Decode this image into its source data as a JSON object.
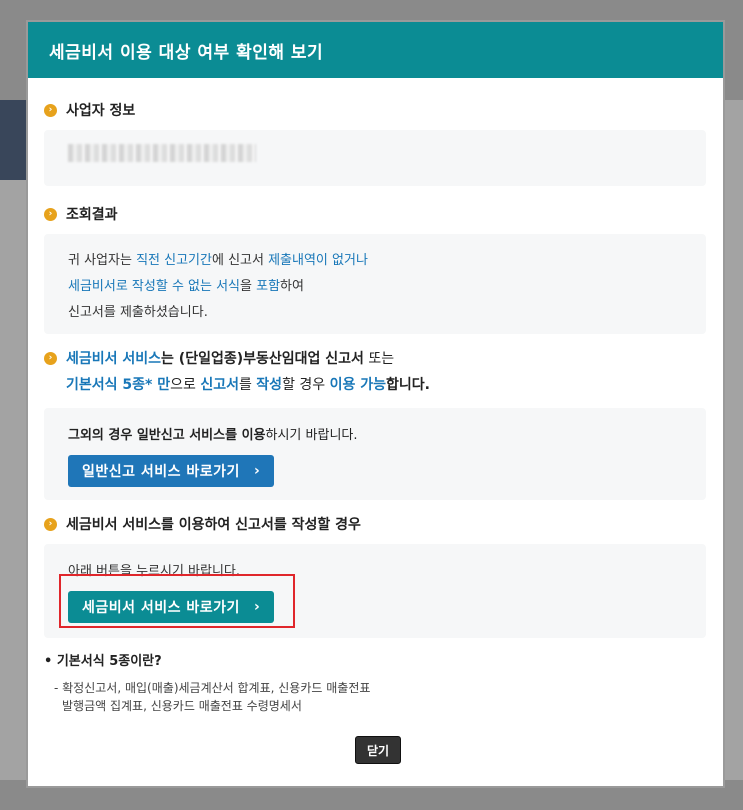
{
  "modal": {
    "title": "세금비서 이용 대상 여부 확인해 보기",
    "business_info": {
      "heading": "사업자 정보"
    },
    "result": {
      "heading": "조회결과",
      "line1_a": "귀 사업자는 ",
      "line1_b": "직전 신고기간",
      "line1_c": "에 신고서 ",
      "line1_d": "제출내역이 없거나",
      "line2_a": "세금비서로 작성할 수 없는 서식",
      "line2_b": "을 ",
      "line2_c": "포함",
      "line2_d": "하여",
      "line3": "신고서를 제출하셨습니다."
    },
    "service_info": {
      "l1_a": "세금비서 서비스",
      "l1_b": "는 (단일업종)부동산임대업 신고서",
      "l1_c": " 또는",
      "l2_a": "기본서식 5종* 만",
      "l2_b": "으로 ",
      "l2_c": "신고서",
      "l2_d": "를 ",
      "l2_e": "작성",
      "l2_f": "할 경우 ",
      "l2_g": "이용 가능",
      "l2_h": "합니다.",
      "box_a": "그외의 경우 일반신고 서비스를 이용",
      "box_b": "하시기 바랍니다.",
      "button": "일반신고 서비스 바로가기"
    },
    "write_section": {
      "heading": "세금비서 서비스를 이용하여 신고서를 작성할 경우",
      "desc": "아래 버튼을 누르시기 바랍니다.",
      "button": "세금비서 서비스 바로가기"
    },
    "note": {
      "title": "• 기본서식 5종이란?",
      "line1": "- 확정신고서, 매입(매출)세금계산서 합계표, 신용카드 매출전표",
      "line2": "발행금액 집계표, 신용카드 매출전표 수령명세서"
    },
    "close_button": "닫기"
  },
  "icons": {
    "bullet": "chevron-right-circle-icon",
    "button_arrow": "chevron-right-icon"
  },
  "colors": {
    "header": "#0b8c94",
    "link_blue": "#1877b8",
    "bullet": "#e7a21c",
    "highlight_box": "#e0262b"
  }
}
